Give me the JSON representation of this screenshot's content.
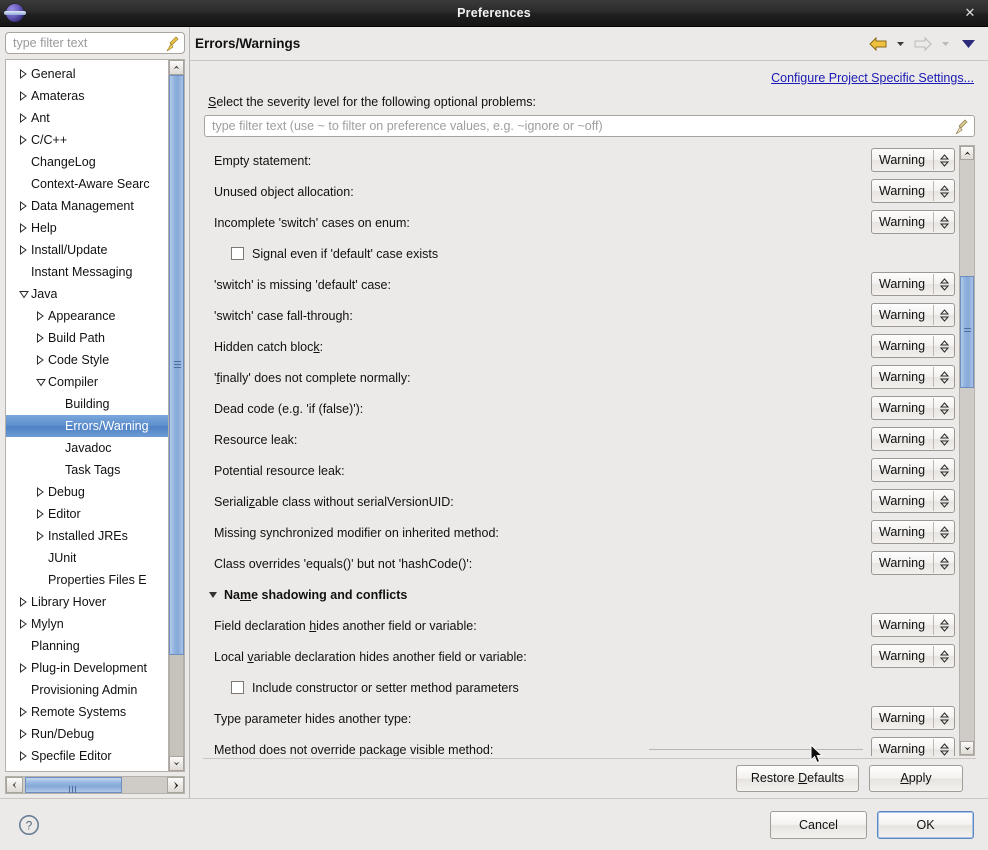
{
  "window": {
    "title": "Preferences",
    "app_icon": "eclipse-icon",
    "close_label": "✕"
  },
  "sidebar": {
    "filter": {
      "placeholder": "type filter text",
      "value": "",
      "clear_icon": "broom-icon"
    },
    "tree": [
      {
        "label": "General",
        "level": 0,
        "twisty": "collapsed",
        "selected": false
      },
      {
        "label": "Amateras",
        "level": 0,
        "twisty": "collapsed",
        "selected": false
      },
      {
        "label": "Ant",
        "level": 0,
        "twisty": "collapsed",
        "selected": false
      },
      {
        "label": "C/C++",
        "level": 0,
        "twisty": "collapsed",
        "selected": false
      },
      {
        "label": "ChangeLog",
        "level": 0,
        "twisty": "none",
        "selected": false
      },
      {
        "label": "Context-Aware Searc",
        "level": 0,
        "twisty": "none",
        "selected": false
      },
      {
        "label": "Data Management",
        "level": 0,
        "twisty": "collapsed",
        "selected": false
      },
      {
        "label": "Help",
        "level": 0,
        "twisty": "collapsed",
        "selected": false
      },
      {
        "label": "Install/Update",
        "level": 0,
        "twisty": "collapsed",
        "selected": false
      },
      {
        "label": "Instant Messaging",
        "level": 0,
        "twisty": "none",
        "selected": false
      },
      {
        "label": "Java",
        "level": 0,
        "twisty": "expanded",
        "selected": false
      },
      {
        "label": "Appearance",
        "level": 1,
        "twisty": "collapsed",
        "selected": false
      },
      {
        "label": "Build Path",
        "level": 1,
        "twisty": "collapsed",
        "selected": false
      },
      {
        "label": "Code Style",
        "level": 1,
        "twisty": "collapsed",
        "selected": false
      },
      {
        "label": "Compiler",
        "level": 1,
        "twisty": "expanded",
        "selected": false
      },
      {
        "label": "Building",
        "level": 2,
        "twisty": "none",
        "selected": false
      },
      {
        "label": "Errors/Warning",
        "level": 2,
        "twisty": "none",
        "selected": true
      },
      {
        "label": "Javadoc",
        "level": 2,
        "twisty": "none",
        "selected": false
      },
      {
        "label": "Task Tags",
        "level": 2,
        "twisty": "none",
        "selected": false
      },
      {
        "label": "Debug",
        "level": 1,
        "twisty": "collapsed",
        "selected": false
      },
      {
        "label": "Editor",
        "level": 1,
        "twisty": "collapsed",
        "selected": false
      },
      {
        "label": "Installed JREs",
        "level": 1,
        "twisty": "collapsed",
        "selected": false
      },
      {
        "label": "JUnit",
        "level": 1,
        "twisty": "none",
        "selected": false
      },
      {
        "label": "Properties Files E",
        "level": 1,
        "twisty": "none",
        "selected": false
      },
      {
        "label": "Library Hover",
        "level": 0,
        "twisty": "collapsed",
        "selected": false
      },
      {
        "label": "Mylyn",
        "level": 0,
        "twisty": "collapsed",
        "selected": false
      },
      {
        "label": "Planning",
        "level": 0,
        "twisty": "none",
        "selected": false
      },
      {
        "label": "Plug-in Development",
        "level": 0,
        "twisty": "collapsed",
        "selected": false
      },
      {
        "label": "Provisioning Admin",
        "level": 0,
        "twisty": "none",
        "selected": false
      },
      {
        "label": "Remote Systems",
        "level": 0,
        "twisty": "collapsed",
        "selected": false
      },
      {
        "label": "Run/Debug",
        "level": 0,
        "twisty": "collapsed",
        "selected": false
      },
      {
        "label": "Specfile Editor",
        "level": 0,
        "twisty": "collapsed",
        "selected": false
      }
    ]
  },
  "page": {
    "title": "Errors/Warnings",
    "nav": {
      "back_icon": "back-arrow-icon",
      "back_menu_icon": "chevron-down-icon",
      "forward_icon": "forward-arrow-icon",
      "forward_menu_icon": "chevron-down-icon",
      "menu_icon": "chevron-down-large-icon"
    },
    "configure_link": "Configure Project Specific Settings...",
    "severity_label": "Select the severity level for the following optional problems:",
    "severity_label_mnemonic": "S",
    "filter": {
      "placeholder": "type filter text (use ~ to filter on preference values, e.g. ~ignore or ~off)",
      "value": "",
      "clear_icon": "broom-icon"
    }
  },
  "options": [
    {
      "kind": "combo",
      "label": "Empty statement:",
      "value": "Warning"
    },
    {
      "kind": "combo",
      "label": "Unused object allocation:",
      "value": "Warning"
    },
    {
      "kind": "combo",
      "label": "Incomplete 'switch' cases on enum:",
      "value": "Warning"
    },
    {
      "kind": "check",
      "label": "Signal even if 'default' case exists",
      "checked": false
    },
    {
      "kind": "combo",
      "label": "'switch' is missing 'default' case:",
      "value": "Warning"
    },
    {
      "kind": "combo",
      "label": "'switch' case fall-through:",
      "value": "Warning"
    },
    {
      "kind": "combo",
      "label": "Hidden catch block:",
      "value": "Warning",
      "mnemonic": "k"
    },
    {
      "kind": "combo",
      "label": "'finally' does not complete normally:",
      "value": "Warning",
      "mnemonic": "f"
    },
    {
      "kind": "combo",
      "label": "Dead code (e.g. 'if (false)'):",
      "value": "Warning"
    },
    {
      "kind": "combo",
      "label": "Resource leak:",
      "value": "Warning"
    },
    {
      "kind": "combo",
      "label": "Potential resource leak:",
      "value": "Warning"
    },
    {
      "kind": "combo",
      "label": "Serializable class without serialVersionUID:",
      "value": "Warning",
      "mnemonic": "z"
    },
    {
      "kind": "combo",
      "label": "Missing synchronized modifier on inherited method:",
      "value": "Warning"
    },
    {
      "kind": "combo",
      "label": "Class overrides 'equals()' but not 'hashCode()':",
      "value": "Warning"
    },
    {
      "kind": "section",
      "label": "Name shadowing and conflicts",
      "expanded": true
    },
    {
      "kind": "combo",
      "label": "Field declaration hides another field or variable:",
      "value": "Warning",
      "mnemonic": "h"
    },
    {
      "kind": "combo",
      "label": "Local variable declaration hides another field or variable:",
      "value": "Warning",
      "mnemonic": "v"
    },
    {
      "kind": "check",
      "label": "Include constructor or setter method parameters",
      "checked": false
    },
    {
      "kind": "combo",
      "label": "Type parameter hides another type:",
      "value": "Warning"
    },
    {
      "kind": "combo",
      "label": "Method does not override package visible method:",
      "value": "Warning",
      "clipped": true
    }
  ],
  "actions": {
    "restore_defaults": "Restore Defaults",
    "restore_defaults_mnemonic": "D",
    "apply": "Apply",
    "apply_mnemonic": "A"
  },
  "footer": {
    "help_icon": "help-question-icon",
    "cancel": "Cancel",
    "ok": "OK"
  },
  "colors": {
    "dialog_bg": "#eceae8",
    "selection_blue": "#5d8fcd",
    "link_blue": "#1a1ab4",
    "scrollbar_thumb": "#8fb2de",
    "titlebar": "#232323"
  }
}
